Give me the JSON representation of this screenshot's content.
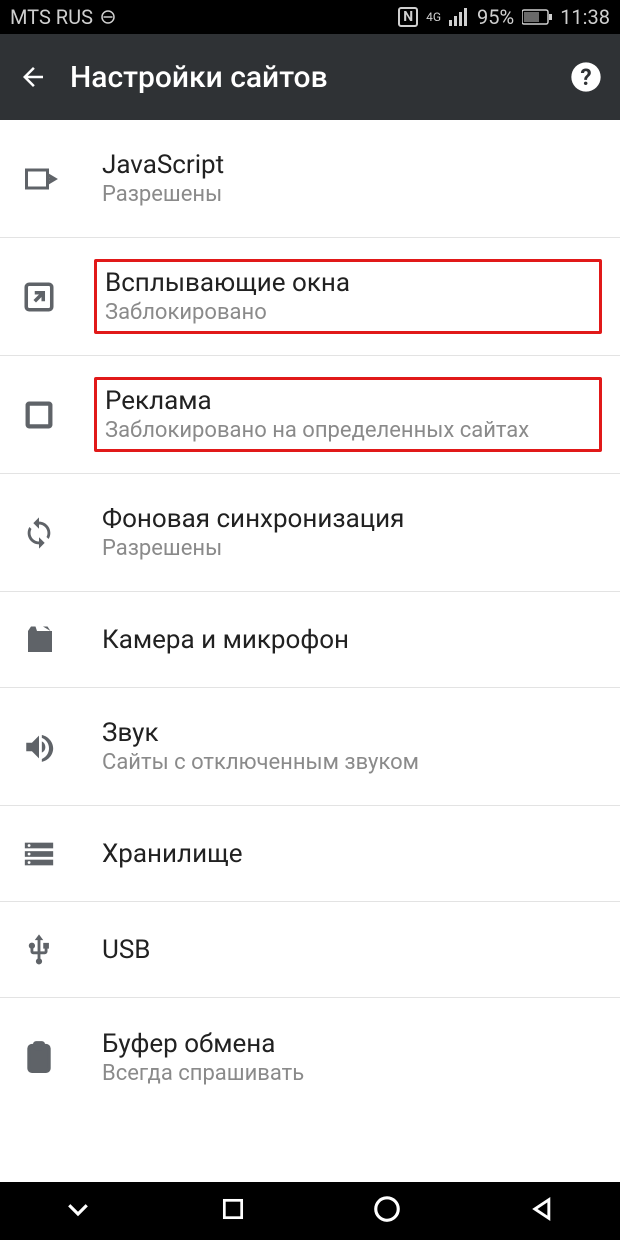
{
  "statusbar": {
    "carrier": "MTS RUS",
    "nfc": "N",
    "network_small": "4G",
    "battery_pct": "95%",
    "time": "11:38"
  },
  "header": {
    "title": "Настройки сайтов"
  },
  "items": [
    {
      "title": "JavaScript",
      "subtitle": "Разрешены"
    },
    {
      "title": "Всплывающие окна",
      "subtitle": "Заблокировано"
    },
    {
      "title": "Реклама",
      "subtitle": "Заблокировано на определенных сайтах"
    },
    {
      "title": "Фоновая синхронизация",
      "subtitle": "Разрешены"
    },
    {
      "title": "Камера и микрофон",
      "subtitle": ""
    },
    {
      "title": "Звук",
      "subtitle": "Сайты с отключенным звуком"
    },
    {
      "title": "Хранилище",
      "subtitle": ""
    },
    {
      "title": "USB",
      "subtitle": ""
    },
    {
      "title": "Буфер обмена",
      "subtitle": "Всегда спрашивать"
    }
  ]
}
